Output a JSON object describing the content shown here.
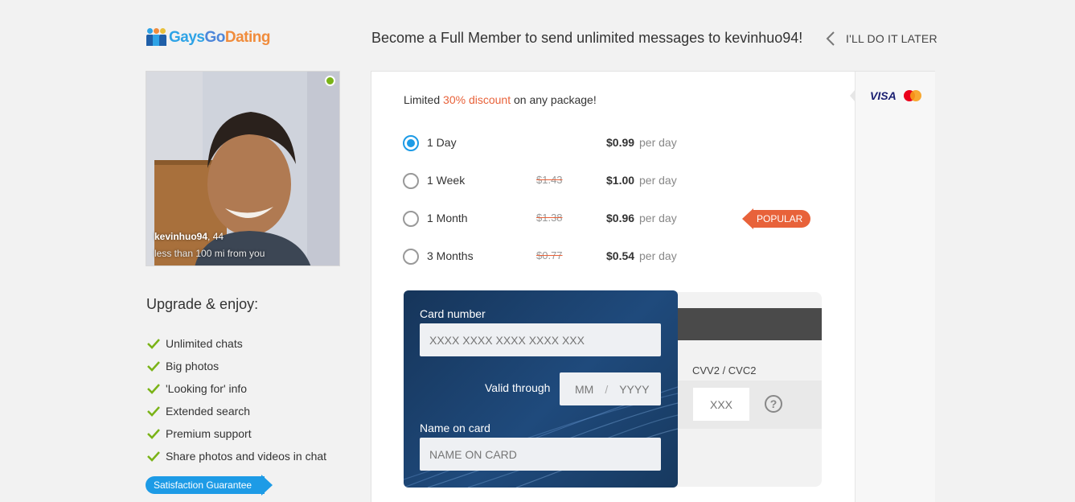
{
  "brand": {
    "logo_part1": "Gays",
    "logo_part2": "Go",
    "logo_part3": "Dating"
  },
  "header": {
    "headline": "Become a Full Member to send unlimited messages to kevinhuo94!",
    "later_label": "I'LL DO IT LATER"
  },
  "profile": {
    "username": "kevinhuo94",
    "age_text": ", 44",
    "distance": "less than 100 mi from you",
    "online": true
  },
  "upgrade": {
    "title": "Upgrade & enjoy:",
    "benefits": [
      "Unlimited chats",
      "Big photos",
      "'Looking for' info",
      "Extended search",
      "Premium support",
      "Share photos and videos in chat"
    ],
    "guarantee": "Satisfaction Guarantee"
  },
  "offer": {
    "prefix": "Limited ",
    "highlight": "30% discount",
    "suffix": " on any package!"
  },
  "packages": [
    {
      "name": "1 Day",
      "old_price": "",
      "price": "$0.99",
      "unit": "per day",
      "selected": true
    },
    {
      "name": "1 Week",
      "old_price": "$1.43",
      "price": "$1.00",
      "unit": "per day",
      "selected": false
    },
    {
      "name": "1 Month",
      "old_price": "$1.38",
      "price": "$0.96",
      "unit": "per day",
      "selected": false
    },
    {
      "name": "3 Months",
      "old_price": "$0.77",
      "price": "$0.54",
      "unit": "per day",
      "selected": false
    }
  ],
  "popular_label": "POPULAR",
  "payment": {
    "card_brand": "VISA",
    "card_number_label": "Card number",
    "card_number_placeholder": "XXXX XXXX XXXX XXXX XXX",
    "valid_label": "Valid through",
    "month_placeholder": "MM",
    "separator": "/",
    "year_placeholder": "YYYY",
    "name_label": "Name on card",
    "name_placeholder": "NAME ON CARD",
    "cvv_label": "CVV2 / CVC2",
    "cvv_placeholder": "XXX",
    "help_symbol": "?"
  },
  "colors": {
    "accent_blue": "#1d9be6",
    "accent_orange": "#e8623a",
    "check_green": "#7ab317",
    "card_navy": "#1f4a7c"
  }
}
